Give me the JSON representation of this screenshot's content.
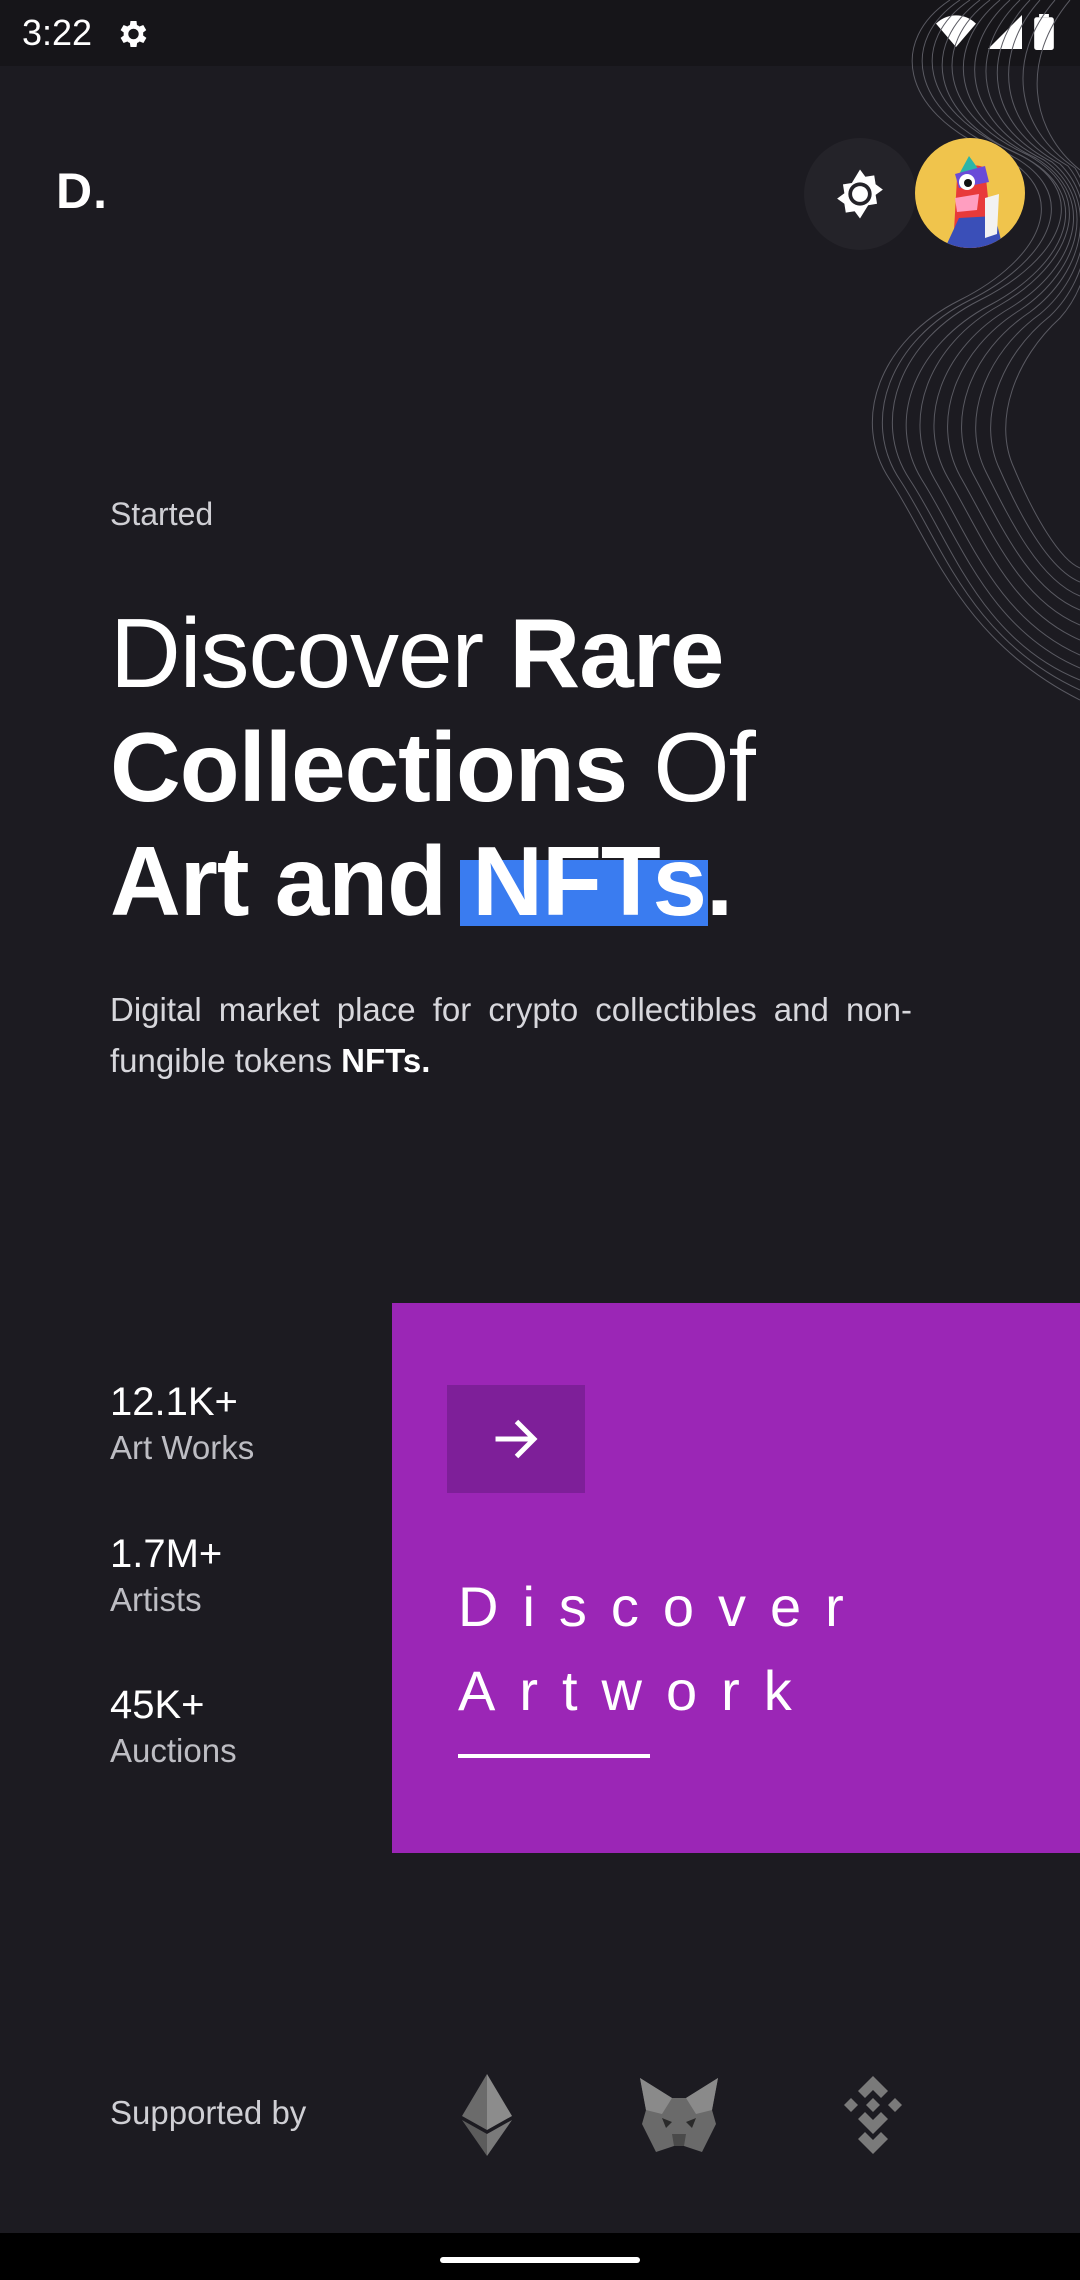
{
  "status_bar": {
    "time": "3:22"
  },
  "header": {
    "logo": "D."
  },
  "hero": {
    "eyebrow": "Started",
    "headline": {
      "w1": "Discover ",
      "w2": "Rare",
      "w3": "Collections",
      "w4": " Of",
      "w5": "Art and ",
      "w6": "NFTs",
      "w7": "."
    },
    "subtitle": "Digital market place for crypto collectibles and non-fungible tokens ",
    "subtitle_strong": "NFTs."
  },
  "stats": [
    {
      "value": "12.1K+",
      "label": "Art Works"
    },
    {
      "value": "1.7M+",
      "label": "Artists"
    },
    {
      "value": "45K+",
      "label": "Auctions"
    }
  ],
  "discover": {
    "line1": "Discover",
    "line2": "Artwork"
  },
  "footer": {
    "supported_label": "Supported by",
    "partners": [
      "ethereum-icon",
      "metamask-icon",
      "binance-icon"
    ]
  },
  "colors": {
    "background": "#1c1b21",
    "accent_purple": "#9b26b6",
    "accent_purple_dark": "#7e1f99",
    "highlight_blue": "#3a7cf0",
    "avatar_bg": "#f0c44c"
  }
}
